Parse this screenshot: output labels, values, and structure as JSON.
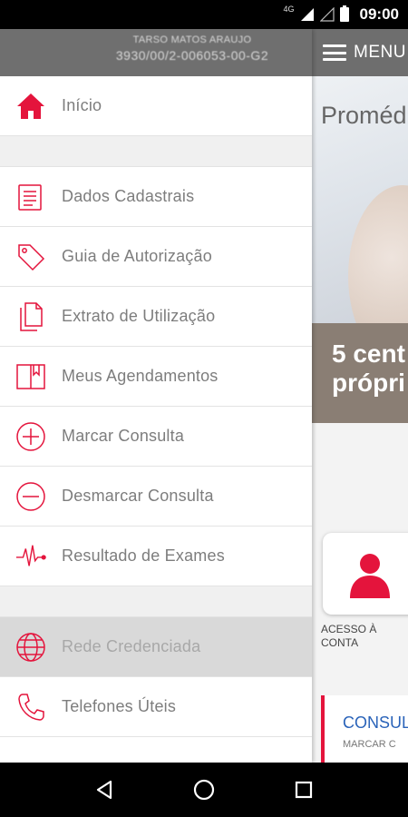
{
  "status_bar": {
    "network": "4G",
    "time": "09:00"
  },
  "drawer": {
    "header": {
      "user_name": "TARSO MATOS ARAUJO",
      "card_number": "3930/00/2-006053-00-G2"
    },
    "items": [
      {
        "label": "Início",
        "icon": "home-icon"
      },
      {
        "label": "Dados Cadastrais",
        "icon": "document-list-icon"
      },
      {
        "label": "Guia de Autorização",
        "icon": "tag-icon"
      },
      {
        "label": "Extrato de Utilização",
        "icon": "documents-icon"
      },
      {
        "label": "Meus Agendamentos",
        "icon": "book-icon"
      },
      {
        "label": "Marcar Consulta",
        "icon": "plus-circle-icon"
      },
      {
        "label": "Desmarcar Consulta",
        "icon": "minus-circle-icon"
      },
      {
        "label": "Resultado de Exames",
        "icon": "heartbeat-icon"
      },
      {
        "label": "Rede Credenciada",
        "icon": "globe-icon"
      },
      {
        "label": "Telefones Úteis",
        "icon": "phone-icon"
      }
    ],
    "active_item": "Rede Credenciada"
  },
  "background_app": {
    "menu_label": "MENU",
    "hero_title": "Proméd",
    "hero_text_line1": "5 cent",
    "hero_text_line2": "própri",
    "card_label": "ACESSO À CONTA",
    "consult_title": "CONSUL",
    "consult_sub": "MARCAR C"
  },
  "colors": {
    "accent": "#e4143c",
    "header_bg": "#6f6f6f",
    "active_bg": "#d9d9d9",
    "link_blue": "#2a63b9"
  }
}
